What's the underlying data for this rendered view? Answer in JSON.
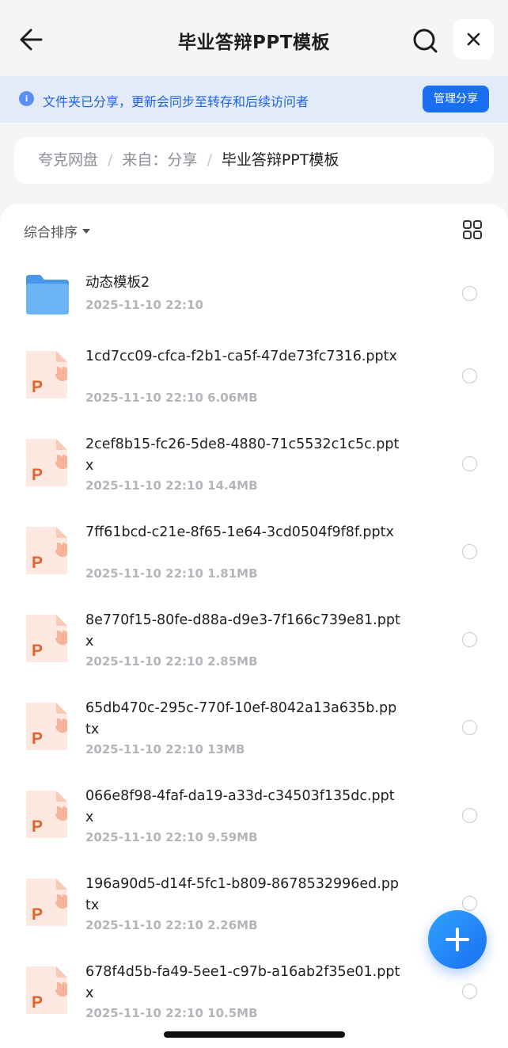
{
  "header": {
    "title": "毕业答辩PPT模板",
    "back_icon": "arrow-left-icon",
    "search_icon": "search-icon",
    "close_icon": "close-icon"
  },
  "banner": {
    "icon": "info-icon",
    "icon_glyph": "i",
    "text": "文件夹已分享，更新会同步至转存和后续访问者",
    "button_label": "管理分享"
  },
  "breadcrumb": {
    "items": [
      "夸克网盘",
      "来自：分享"
    ],
    "separator": "/",
    "current": "毕业答辩PPT模板"
  },
  "toolbar": {
    "sort_label": "综合排序",
    "view_toggle_icon": "grid-view-icon"
  },
  "files": [
    {
      "name": "动态模板2",
      "date": "2025-11-10 22:10",
      "size": "",
      "type": "folder"
    },
    {
      "name": "1cd7cc09-cfca-f2b1-ca5f-47de73fc7316.pptx",
      "date": "2025-11-10 22:10",
      "size": "6.06MB",
      "type": "pptx"
    },
    {
      "name": "2cef8b15-fc26-5de8-4880-71c5532c1c5c.pptx",
      "date": "2025-11-10 22:10",
      "size": "14.4MB",
      "type": "pptx"
    },
    {
      "name": "7ff61bcd-c21e-8f65-1e64-3cd0504f9f8f.pptx",
      "date": "2025-11-10 22:10",
      "size": "1.81MB",
      "type": "pptx"
    },
    {
      "name": "8e770f15-80fe-d88a-d9e3-7f166c739e81.pptx",
      "date": "2025-11-10 22:10",
      "size": "2.85MB",
      "type": "pptx"
    },
    {
      "name": "65db470c-295c-770f-10ef-8042a13a635b.pptx",
      "date": "2025-11-10 22:10",
      "size": "13MB",
      "type": "pptx"
    },
    {
      "name": "066e8f98-4faf-da19-a33d-c34503f135dc.pptx",
      "date": "2025-11-10 22:10",
      "size": "9.59MB",
      "type": "pptx"
    },
    {
      "name": "196a90d5-d14f-5fc1-b809-8678532996ed.pptx",
      "date": "2025-11-10 22:10",
      "size": "2.26MB",
      "type": "pptx"
    },
    {
      "name": "678f4d5b-fa49-5ee1-c97b-a16ab2f35e01.pptx",
      "date": "2025-11-10 22:10",
      "size": "10.5MB",
      "type": "pptx"
    }
  ],
  "fab": {
    "icon": "plus-icon"
  },
  "colors": {
    "accent": "#1a6ff0",
    "banner_bg": "#e3ebf8",
    "banner_text": "#1f63e6",
    "folder": "#5aa7f2",
    "ppt": "#e8602c"
  }
}
